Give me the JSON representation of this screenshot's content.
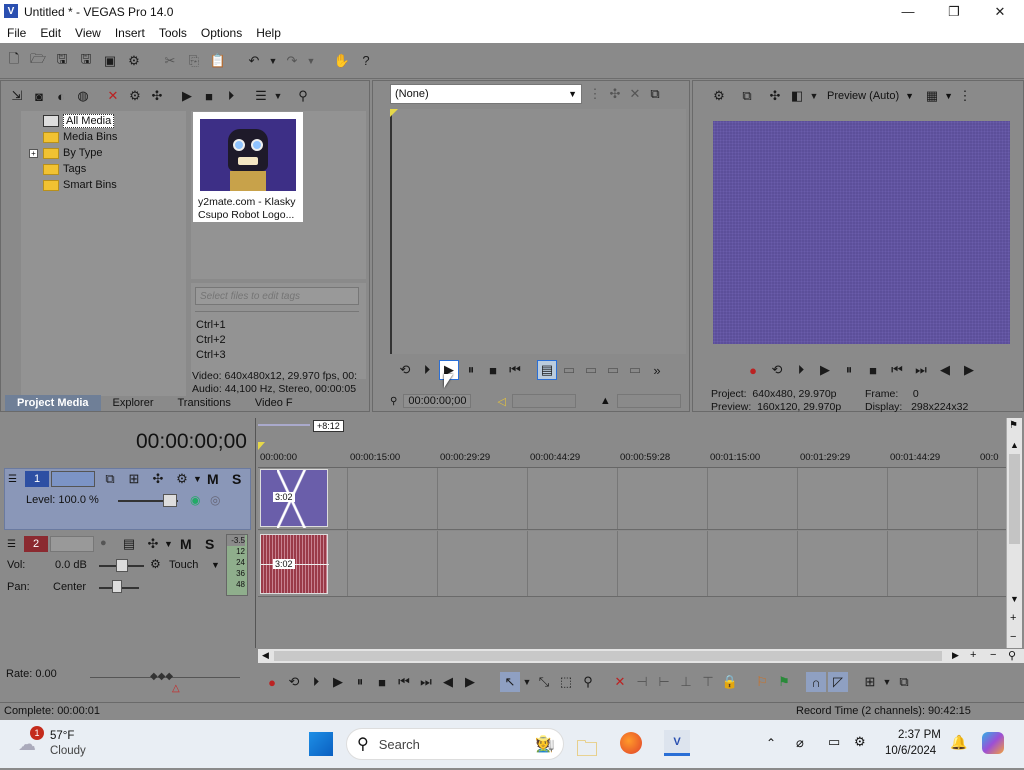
{
  "window": {
    "title": "Untitled * - VEGAS Pro 14.0",
    "minimize": "—",
    "maximize": "❐",
    "close": "✕"
  },
  "menu": [
    "File",
    "Edit",
    "View",
    "Insert",
    "Tools",
    "Options",
    "Help"
  ],
  "project_media": {
    "tree": [
      "All Media",
      "Media Bins",
      "By Type",
      "Tags",
      "Smart Bins"
    ],
    "expander": "+",
    "thumb_caption": "y2mate.com - Klasky Csupo Robot Logo...",
    "tag_placeholder": "Select files to edit tags",
    "shortcuts": [
      "Ctrl+1",
      "Ctrl+2",
      "Ctrl+3"
    ],
    "info_video": "Video: 640x480x12, 29.970 fps, 00:",
    "info_audio": "Audio: 44,100 Hz, Stereo, 00:00:05",
    "tabs": [
      "Project Media",
      "Explorer",
      "Transitions",
      "Video F"
    ]
  },
  "trimmer": {
    "dropdown": "(None)",
    "timecode": "00:00:00;00"
  },
  "preview": {
    "mode": "Preview (Auto)",
    "project": "Project:  640x480, 29.970p",
    "preview_line": "Preview:  160x120, 29.970p",
    "frame": "Frame:     0",
    "display": "Display:   298x224x32"
  },
  "timeline": {
    "timecode": "00:00:00;00",
    "offset": "+8:12",
    "ruler": [
      "00:00:00",
      "00:00:15:00",
      "00:00:29:29",
      "00:00:44:29",
      "00:00:59:28",
      "00:01:15:00",
      "00:01:29:29",
      "00:01:44:29",
      "00:0"
    ],
    "video_track": {
      "number": "1",
      "level": "Level: 100.0 %",
      "m": "M",
      "s": "S",
      "clip_label": "3:02"
    },
    "audio_track": {
      "number": "2",
      "vol_label": "Vol:",
      "vol_value": "0.0 dB",
      "pan_label": "Pan:",
      "pan_value": "Center",
      "touch": "Touch",
      "m": "M",
      "s": "S",
      "clip_label": "3:02",
      "meter": [
        "-3.5",
        "12",
        "24",
        "36",
        "48"
      ]
    },
    "rate": "Rate: 0.00"
  },
  "status": {
    "left": "Complete: 00:00:01",
    "right": "Record Time (2 channels): 90:42:15"
  },
  "taskbar": {
    "weather_temp": "57°F",
    "weather_desc": "Cloudy",
    "weather_badge": "1",
    "search": "Search",
    "time": "2:37 PM",
    "date": "10/6/2024"
  },
  "colors": {
    "accent": "#2a6fd6",
    "preview_bg": "#5c4f9a",
    "track_head": "#8a97b8"
  }
}
